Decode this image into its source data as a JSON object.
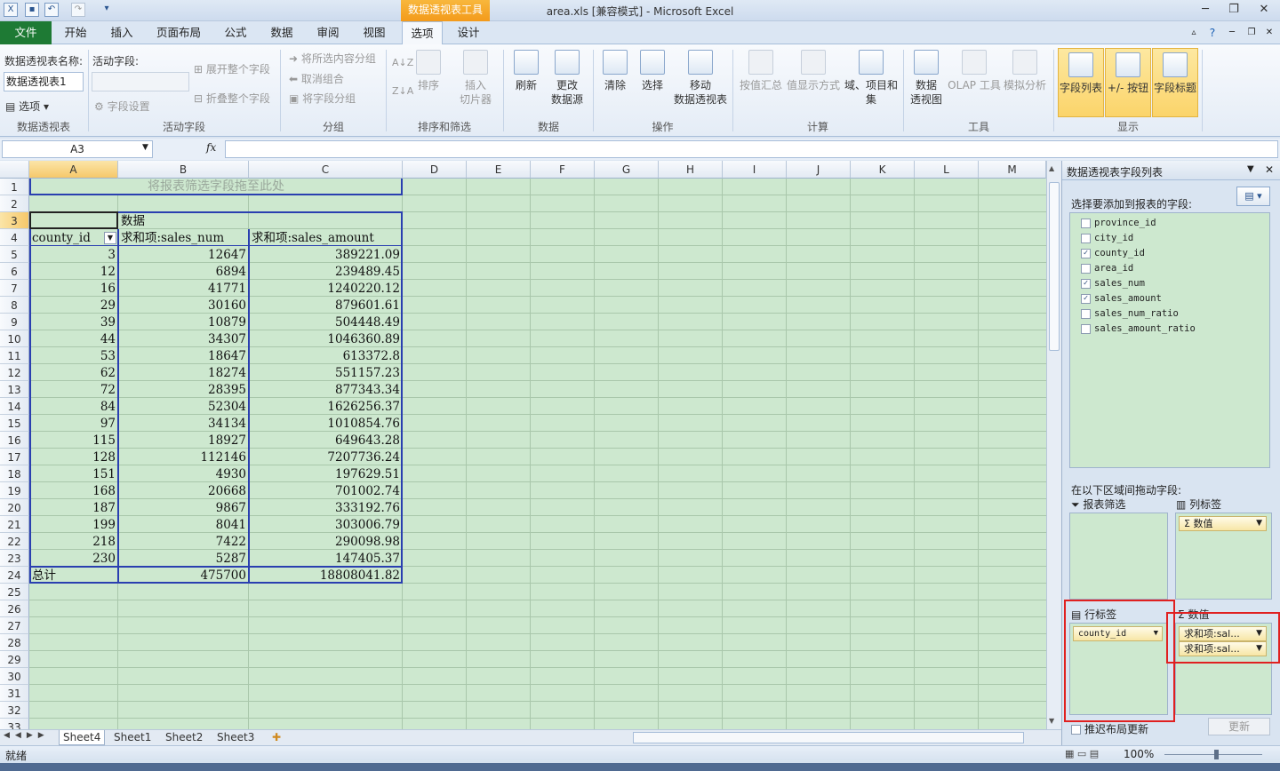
{
  "window": {
    "title": "area.xls  [兼容模式] - Microsoft Excel",
    "context_tab": "数据透视表工具"
  },
  "tabs": [
    "文件",
    "开始",
    "插入",
    "页面布局",
    "公式",
    "数据",
    "审阅",
    "视图",
    "选项",
    "设计"
  ],
  "active_tab": "选项",
  "ribbon": {
    "pivot_name_label": "数据透视表名称:",
    "pivot_name_value": "数据透视表1",
    "options_btn": "选项",
    "group_pivot": "数据透视表",
    "active_field_label": "活动字段:",
    "field_settings": "字段设置",
    "expand_all": "展开整个字段",
    "collapse_all": "折叠整个字段",
    "group_active": "活动字段",
    "group_selection": "将所选内容分组",
    "ungroup": "取消组合",
    "group_field": "将字段分组",
    "group_grouping": "分组",
    "sort": "排序",
    "insert_slicer": "插入\n切片器",
    "group_sort": "排序和筛选",
    "refresh": "刷新",
    "change_source": "更改\n数据源",
    "group_data": "数据",
    "clear": "清除",
    "select": "选择",
    "move_pivot": "移动\n数据透视表",
    "group_actions": "操作",
    "summarize": "按值汇总",
    "show_values": "值显示方式",
    "fields_items": "域、项目和\n集",
    "group_calc": "计算",
    "pivot_chart": "数据\n透视图",
    "olap": "OLAP 工具",
    "whatif": "模拟分析",
    "group_tools": "工具",
    "field_list": "字段列表",
    "buttons": "+/- 按钮",
    "field_headers": "字段标题",
    "group_show": "显示"
  },
  "formula_bar": {
    "name_box": "A3",
    "fx": "fx",
    "value": ""
  },
  "columns": [
    "A",
    "B",
    "C",
    "D",
    "E",
    "F",
    "G",
    "H",
    "I",
    "J",
    "K",
    "L",
    "M"
  ],
  "pivot": {
    "filter_drop": "将报表筛选字段拖至此处",
    "data_caption": "数据",
    "headers": [
      "county_id",
      "求和项:sales_num",
      "求和项:sales_amount"
    ],
    "rows": [
      [
        "3",
        "12647",
        "389221.09"
      ],
      [
        "12",
        "6894",
        "239489.45"
      ],
      [
        "16",
        "41771",
        "1240220.12"
      ],
      [
        "29",
        "30160",
        "879601.61"
      ],
      [
        "39",
        "10879",
        "504448.49"
      ],
      [
        "44",
        "34307",
        "1046360.89"
      ],
      [
        "53",
        "18647",
        "613372.8"
      ],
      [
        "62",
        "18274",
        "551157.23"
      ],
      [
        "72",
        "28395",
        "877343.34"
      ],
      [
        "84",
        "52304",
        "1626256.37"
      ],
      [
        "97",
        "34134",
        "1010854.76"
      ],
      [
        "115",
        "18927",
        "649643.28"
      ],
      [
        "128",
        "112146",
        "7207736.24"
      ],
      [
        "151",
        "4930",
        "197629.51"
      ],
      [
        "168",
        "20668",
        "701002.74"
      ],
      [
        "187",
        "9867",
        "333192.76"
      ],
      [
        "199",
        "8041",
        "303006.79"
      ],
      [
        "218",
        "7422",
        "290098.98"
      ],
      [
        "230",
        "5287",
        "147405.37"
      ]
    ],
    "total": [
      "总计",
      "475700",
      "18808041.82"
    ]
  },
  "sheets": [
    "Sheet4",
    "Sheet1",
    "Sheet2",
    "Sheet3"
  ],
  "status": {
    "ready": "就绪",
    "zoom": "100%"
  },
  "field_list": {
    "title": "数据透视表字段列表",
    "choose_label": "选择要添加到报表的字段:",
    "fields": [
      {
        "name": "province_id",
        "checked": false
      },
      {
        "name": "city_id",
        "checked": false
      },
      {
        "name": "county_id",
        "checked": true
      },
      {
        "name": "area_id",
        "checked": false
      },
      {
        "name": "sales_num",
        "checked": true
      },
      {
        "name": "sales_amount",
        "checked": true
      },
      {
        "name": "sales_num_ratio",
        "checked": false
      },
      {
        "name": "sales_amount_ratio",
        "checked": false
      }
    ],
    "drag_label": "在以下区域间拖动字段:",
    "report_filter": "报表筛选",
    "column_labels": "列标签",
    "column_chip": "数值",
    "row_labels": "行标签",
    "row_chip": "county_id",
    "values": "数值",
    "value_chips": [
      "求和项:sal...",
      "求和项:sal..."
    ],
    "defer_update": "推迟布局更新",
    "update_btn": "更新"
  }
}
